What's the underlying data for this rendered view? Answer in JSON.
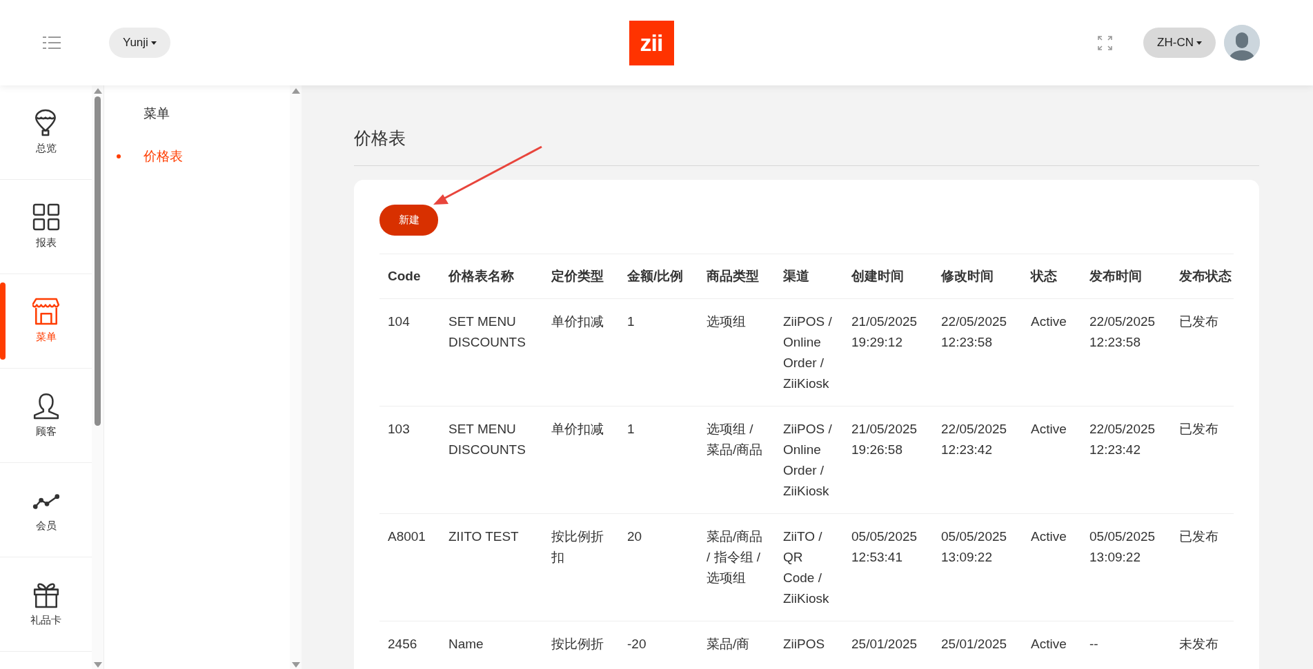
{
  "header": {
    "store": "Yunji",
    "logo": "zii",
    "language": "ZH-CN"
  },
  "sidebar": {
    "items": [
      {
        "label": "总览",
        "kind": "balloon",
        "selected": false
      },
      {
        "label": "报表",
        "kind": "grid",
        "selected": false
      },
      {
        "label": "菜单",
        "kind": "store",
        "selected": true
      },
      {
        "label": "顾客",
        "kind": "person",
        "selected": false
      },
      {
        "label": "会员",
        "kind": "chart",
        "selected": false
      },
      {
        "label": "礼品卡",
        "kind": "gift",
        "selected": false
      }
    ]
  },
  "subnav": {
    "items": [
      {
        "label": "菜单",
        "selected": false
      },
      {
        "label": "价格表",
        "selected": true
      }
    ]
  },
  "page_title": "价格表",
  "new_button": "新建",
  "table": {
    "columns": [
      "Code",
      "价格表名称",
      "定价类型",
      "金额/比例",
      "商品类型",
      "渠道",
      "创建时间",
      "修改时间",
      "状态",
      "发布时间",
      "发布状态"
    ],
    "rows": [
      [
        "104",
        "SET MENU DISCOUNTS",
        "单价扣减",
        "1",
        "选项组",
        "ZiiPOS / Online Order / ZiiKiosk",
        "21/05/2025 19:29:12",
        "22/05/2025 12:23:58",
        "Active",
        "22/05/2025 12:23:58",
        "已发布"
      ],
      [
        "103",
        "SET MENU DISCOUNTS",
        "单价扣减",
        "1",
        "选项组 / 菜品/商品",
        "ZiiPOS / Online Order / ZiiKiosk",
        "21/05/2025 19:26:58",
        "22/05/2025 12:23:42",
        "Active",
        "22/05/2025 12:23:42",
        "已发布"
      ],
      [
        "A8001",
        "ZIITO TEST",
        "按比例折扣",
        "20",
        "菜品/商品 / 指令组 / 选项组",
        "ZiiTO / QR Code / ZiiKiosk",
        "05/05/2025 12:53:41",
        "05/05/2025 13:09:22",
        "Active",
        "05/05/2025 13:09:22",
        "已发布"
      ],
      [
        "2456",
        "Name",
        "按比例折",
        "-20",
        "菜品/商",
        "ZiiPOS",
        "25/01/2025",
        "25/01/2025",
        "Active",
        "--",
        "未发布"
      ]
    ]
  }
}
